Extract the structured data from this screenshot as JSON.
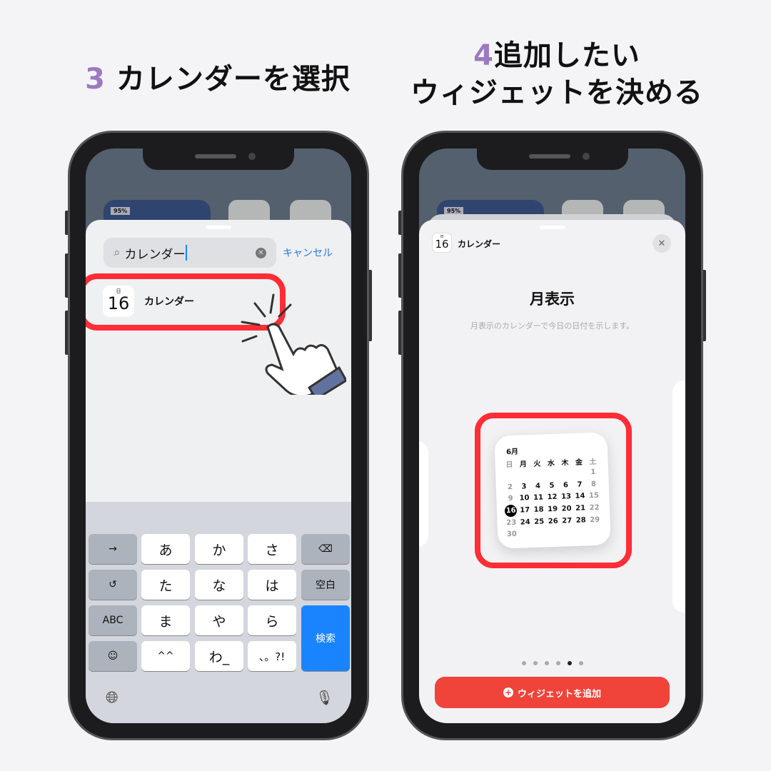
{
  "headings": {
    "left_num": "3",
    "left_text": "カレンダーを選択",
    "right_num": "4",
    "right_line1": "追加したい",
    "right_line2": "ウィジェットを決める"
  },
  "left_phone": {
    "battery_label": "95%",
    "search": {
      "value": "カレンダー",
      "cancel": "キャンセル"
    },
    "result": {
      "icon_day": "日",
      "icon_date": "16",
      "label": "カレンダー"
    },
    "keyboard": {
      "rows": [
        [
          "→",
          "あ",
          "か",
          "さ",
          "⌫"
        ],
        [
          "↺",
          "た",
          "な",
          "は",
          "空白"
        ],
        [
          "ABC",
          "ま",
          "や",
          "ら",
          "検索"
        ],
        [
          "☺",
          "^^",
          "わ_",
          "、。?!"
        ]
      ],
      "globe": "globe-icon",
      "mic": "mic-icon"
    }
  },
  "right_phone": {
    "battery_label": "95%",
    "app_icon_date": "16",
    "app_icon_day": "日",
    "app_name": "カレンダー",
    "widget_title": "月表示",
    "widget_desc": "月表示のカレンダーで今日の日付を示します。",
    "calendar": {
      "month": "6月",
      "weekdays": [
        "日",
        "月",
        "火",
        "水",
        "木",
        "金",
        "土"
      ],
      "weeks": [
        [
          "",
          "",
          "",
          "",
          "",
          "",
          "1"
        ],
        [
          "2",
          "3",
          "4",
          "5",
          "6",
          "7",
          "8"
        ],
        [
          "9",
          "10",
          "11",
          "12",
          "13",
          "14",
          "15"
        ],
        [
          "16",
          "17",
          "18",
          "19",
          "20",
          "21",
          "22"
        ],
        [
          "23",
          "24",
          "25",
          "26",
          "27",
          "28",
          "29"
        ],
        [
          "30",
          "",
          "",
          "",
          "",
          "",
          ""
        ]
      ],
      "today": "16"
    },
    "page_dots": 6,
    "active_dot": 5,
    "add_button": "ウィジェットを追加"
  },
  "colors": {
    "accent_red": "#f0433a",
    "highlight": "#ff2d35",
    "blue": "#1a84ff",
    "number_purple": "#9b7ac0"
  }
}
